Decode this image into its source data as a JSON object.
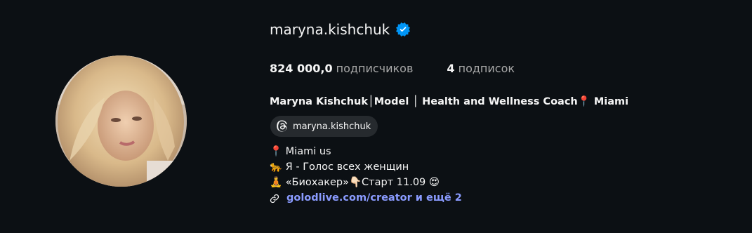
{
  "profile": {
    "username": "maryna.kishchuk",
    "verified_icon": "verified-badge-icon",
    "colors": {
      "background": "#0c1014",
      "verified": "#0095f6",
      "link": "#8a9bff",
      "pill": "#262a2e",
      "muted": "#a8a8a8"
    }
  },
  "stats": {
    "followers_count": "824 000,0",
    "followers_label": "подписчиков",
    "following_count": "4",
    "following_label": "подписок"
  },
  "bio": {
    "full_name": "Maryna Kishchuk│Model │ Health and Wellness Coach📍 Miami",
    "threads_handle": "maryna.kishchuk",
    "lines": [
      "📍 Miami us",
      "🐆 Я - Голос всех женщин",
      "🧘 «Биохакер»👇🏻Старт 11.09 😍"
    ],
    "link_text": "golodlive.com/creator и ещё 2"
  }
}
